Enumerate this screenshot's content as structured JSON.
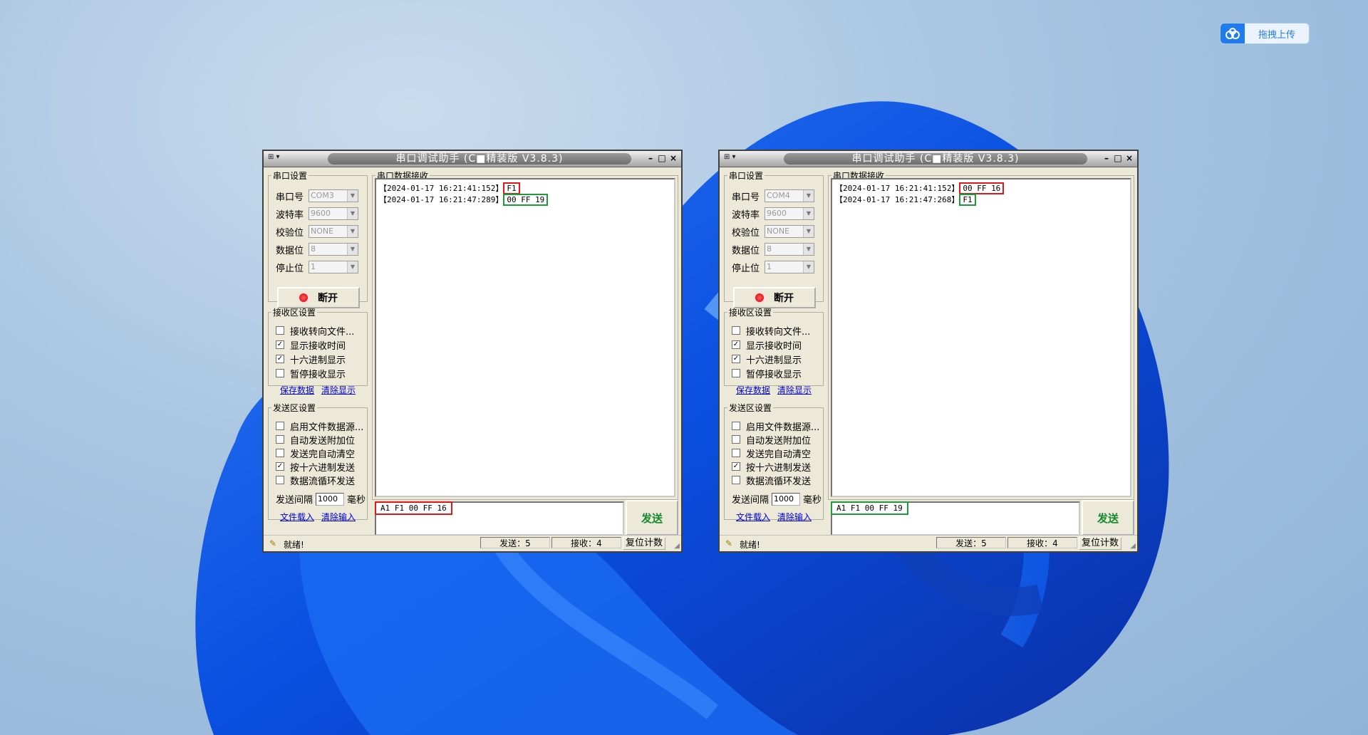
{
  "upload_widget": {
    "label": "拖拽上传",
    "icon": "cloud-upload-icon"
  },
  "windows": [
    {
      "title": "串口调试助手 (C■精装版 V3.8.3)",
      "serial": {
        "legend": "串口设置",
        "port_label": "串口号",
        "port": "COM3",
        "baud_label": "波特率",
        "baud": "9600",
        "parity_label": "校验位",
        "parity": "NONE",
        "databits_label": "数据位",
        "databits": "8",
        "stopbits_label": "停止位",
        "stopbits": "1",
        "open_label": "断开"
      },
      "recv_settings": {
        "legend": "接收区设置",
        "items": [
          {
            "label": "接收转向文件...",
            "checked": false
          },
          {
            "label": "显示接收时间",
            "checked": true
          },
          {
            "label": "十六进制显示",
            "checked": true
          },
          {
            "label": "暂停接收显示",
            "checked": false
          }
        ],
        "save_label": "保存数据",
        "clear_label": "清除显示"
      },
      "send_settings": {
        "legend": "发送区设置",
        "items": [
          {
            "label": "启用文件数据源...",
            "checked": false
          },
          {
            "label": "自动发送附加位",
            "checked": false
          },
          {
            "label": "发送完自动清空",
            "checked": false
          },
          {
            "label": "按十六进制发送",
            "checked": true
          },
          {
            "label": "数据流循环发送",
            "checked": false
          }
        ],
        "interval_label": "发送间隔",
        "interval": "1000",
        "unit": "毫秒",
        "load_label": "文件载入",
        "clear_input_label": "清除输入"
      },
      "recv": {
        "legend": "串口数据接收",
        "lines": [
          {
            "time": "【2024-01-17 16:21:41:152】",
            "data": "F1",
            "highlight": "#e3161d"
          },
          {
            "time": "【2024-01-17 16:21:47:289】",
            "data": "00 FF 19",
            "highlight": "#1b9b3a"
          }
        ]
      },
      "send_input": "A1 F1 00 FF 16",
      "send_input_highlight": "#e3161d",
      "send_label": "发送",
      "status": {
        "ready": "就绪!",
        "sent": "发送：5",
        "received": "接收：4",
        "reset": "复位计数"
      }
    },
    {
      "title": "串口调试助手 (C■精装版 V3.8.3)",
      "serial": {
        "legend": "串口设置",
        "port_label": "串口号",
        "port": "COM4",
        "baud_label": "波特率",
        "baud": "9600",
        "parity_label": "校验位",
        "parity": "NONE",
        "databits_label": "数据位",
        "databits": "8",
        "stopbits_label": "停止位",
        "stopbits": "1",
        "open_label": "断开"
      },
      "recv_settings": {
        "legend": "接收区设置",
        "items": [
          {
            "label": "接收转向文件...",
            "checked": false
          },
          {
            "label": "显示接收时间",
            "checked": true
          },
          {
            "label": "十六进制显示",
            "checked": true
          },
          {
            "label": "暂停接收显示",
            "checked": false
          }
        ],
        "save_label": "保存数据",
        "clear_label": "清除显示"
      },
      "send_settings": {
        "legend": "发送区设置",
        "items": [
          {
            "label": "启用文件数据源...",
            "checked": false
          },
          {
            "label": "自动发送附加位",
            "checked": false
          },
          {
            "label": "发送完自动清空",
            "checked": false
          },
          {
            "label": "按十六进制发送",
            "checked": true
          },
          {
            "label": "数据流循环发送",
            "checked": false
          }
        ],
        "interval_label": "发送间隔",
        "interval": "1000",
        "unit": "毫秒",
        "load_label": "文件载入",
        "clear_input_label": "清除输入"
      },
      "recv": {
        "legend": "串口数据接收",
        "lines": [
          {
            "time": "【2024-01-17 16:21:41:152】",
            "data": "00 FF 16",
            "highlight": "#e3161d"
          },
          {
            "time": "【2024-01-17 16:21:47:268】",
            "data": "F1",
            "highlight": "#1b9b3a"
          }
        ]
      },
      "send_input": "A1 F1 00 FF 19",
      "send_input_highlight": "#1b9b3a",
      "send_label": "发送",
      "status": {
        "ready": "就绪!",
        "sent": "发送：5",
        "received": "接收：4",
        "reset": "复位计数"
      }
    }
  ]
}
